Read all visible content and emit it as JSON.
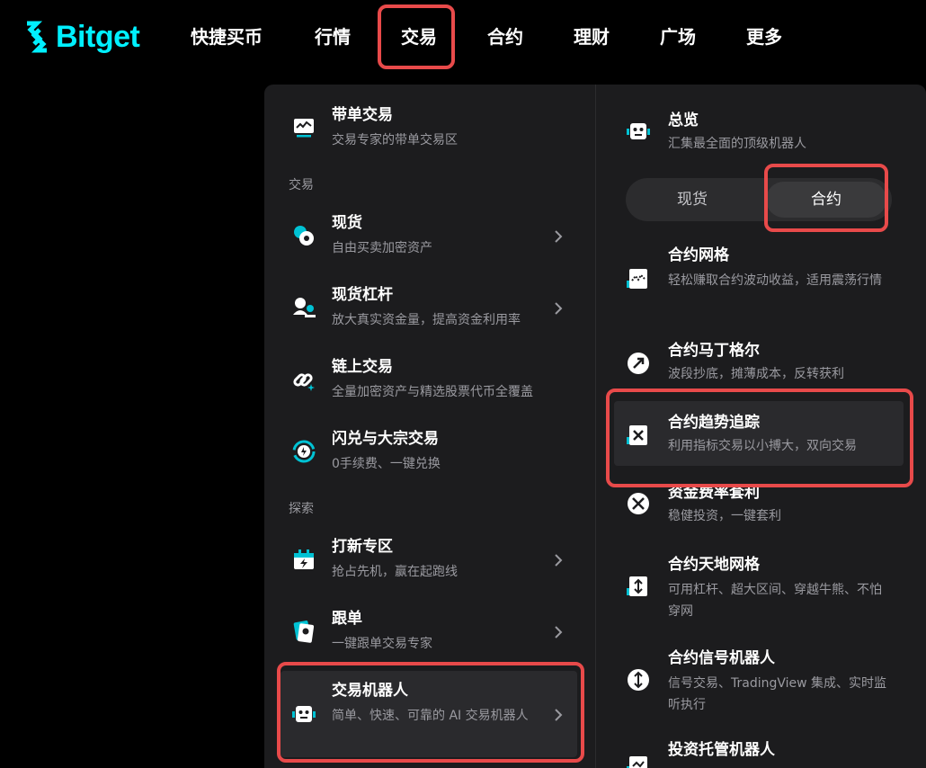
{
  "brand": {
    "name": "Bitget",
    "color": "#00f0ff"
  },
  "nav": [
    {
      "label": "快捷买币"
    },
    {
      "label": "行情"
    },
    {
      "label": "交易"
    },
    {
      "label": "合约"
    },
    {
      "label": "理财"
    },
    {
      "label": "广场"
    },
    {
      "label": "更多"
    }
  ],
  "left": {
    "featured": {
      "title": "带单交易",
      "desc": "交易专家的带单交易区",
      "icon": "chart-monitor-icon"
    },
    "sections": [
      {
        "label": "交易",
        "items": [
          {
            "title": "现货",
            "desc": "自由买卖加密资产",
            "icon": "coins-icon",
            "chevron": true
          },
          {
            "title": "现货杠杆",
            "desc": "放大真实资金量，提高资金利用率",
            "icon": "leverage-icon",
            "chevron": true
          },
          {
            "title": "链上交易",
            "desc": "全量加密资产与精选股票代币全覆盖",
            "icon": "chain-link-icon",
            "chevron": false
          },
          {
            "title": "闪兑与大宗交易",
            "desc": "0手续费、一键兑换",
            "icon": "swap-icon",
            "chevron": false
          }
        ]
      },
      {
        "label": "探索",
        "items": [
          {
            "title": "打新专区",
            "desc": "抢占先机，赢在起跑线",
            "icon": "calendar-bolt-icon",
            "chevron": true
          },
          {
            "title": "跟单",
            "desc": "一键跟单交易专家",
            "icon": "copy-card-icon",
            "chevron": true
          },
          {
            "title": "交易机器人",
            "desc": "简单、快速、可靠的 AI 交易机器人",
            "icon": "robot-icon",
            "chevron": true
          }
        ]
      }
    ]
  },
  "right": {
    "overview": {
      "title": "总览",
      "desc": "汇集最全面的顶级机器人",
      "icon": "robot-icon"
    },
    "toggle": {
      "options": [
        "现货",
        "合约"
      ],
      "selected": "合约"
    },
    "items": [
      {
        "title": "合约网格",
        "desc": "轻松赚取合约波动收益，适用震荡行情",
        "icon": "grid-chart-icon"
      },
      {
        "title": "合约马丁格尔",
        "desc": "波段抄底，摊薄成本，反转获利",
        "icon": "martingale-icon"
      },
      {
        "title": "合约趋势追踪",
        "desc": "利用指标交易以小搏大，双向交易",
        "icon": "trend-icon"
      },
      {
        "title": "资金费率套利",
        "desc": "稳健投资，一键套利",
        "icon": "arbitrage-icon"
      },
      {
        "title": "合约天地网格",
        "desc": "可用杠杆、超大区间、穿越牛熊、不怕穿网",
        "icon": "range-grid-icon"
      },
      {
        "title": "合约信号机器人",
        "desc": "信号交易、TradingView 集成、实时监听执行",
        "icon": "signal-icon"
      },
      {
        "title": "投资托管机器人",
        "desc": "",
        "icon": "custody-icon"
      }
    ]
  },
  "colors": {
    "highlight": "#e84a4a",
    "panel": "#1c1c1e",
    "muted_text": "#9a9aa0",
    "accent": "#00c2d4"
  }
}
